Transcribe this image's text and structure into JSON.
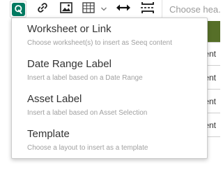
{
  "toolbar": {
    "seeq_icon": "seeq-logo-icon",
    "accent_color": "#007960",
    "buttons": [
      "link-icon",
      "image-icon",
      "table-icon",
      "chevron-down-icon",
      "horizontal-resize-icon",
      "vertical-split-icon"
    ],
    "heading_select": {
      "placeholder": "Choose hea..."
    }
  },
  "background": {
    "row_texts": [
      "tent",
      "tent",
      "tent",
      "tent"
    ],
    "header_color": "#566f28"
  },
  "menu": {
    "items": [
      {
        "title": "Worksheet or Link",
        "description": "Choose worksheet(s) to insert as Seeq content"
      },
      {
        "title": "Date Range Label",
        "description": "Insert a label based on a Date Range"
      },
      {
        "title": "Asset Label",
        "description": "Insert a label based on Asset Selection"
      },
      {
        "title": "Template",
        "description": "Choose a layout to insert as a template"
      }
    ]
  }
}
